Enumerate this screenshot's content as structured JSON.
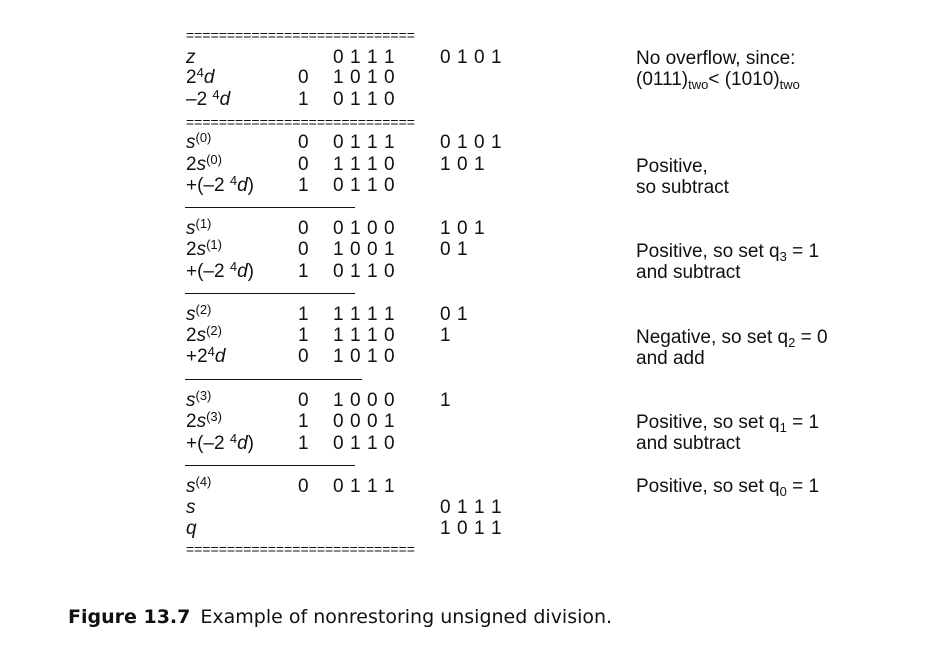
{
  "separator": "============================",
  "rows": [
    {
      "id": "z",
      "label": "z",
      "sign": "",
      "hi": "0 1 1 1",
      "lo": "0 1 0 1"
    },
    {
      "id": "24d",
      "label": "2⁴d",
      "sign": "0",
      "hi": "1 0 1 0",
      "lo": ""
    },
    {
      "id": "neg24d",
      "label": "–2 ⁴d",
      "sign": "1",
      "hi": "0 1 1 0",
      "lo": ""
    },
    {
      "id": "s0",
      "label": "s(0)",
      "sign": "0",
      "hi": "0 1 1 1",
      "lo": "0 1 0 1"
    },
    {
      "id": "2s0",
      "label": "2s(0)",
      "sign": "0",
      "hi": "1 1 1 0",
      "lo": "1 0 1"
    },
    {
      "id": "add0",
      "label": "+(–2 ⁴d)",
      "sign": "1",
      "hi": "0 1 1 0",
      "lo": ""
    },
    {
      "id": "s1",
      "label": "s(1)",
      "sign": "0",
      "hi": "0 1 0 0",
      "lo": "1 0 1"
    },
    {
      "id": "2s1",
      "label": "2s(1)",
      "sign": "0",
      "hi": "1 0 0 1",
      "lo": "0 1"
    },
    {
      "id": "add1",
      "label": "+(–2 ⁴d)",
      "sign": "1",
      "hi": "0 1 1 0",
      "lo": ""
    },
    {
      "id": "s2",
      "label": "s(2)",
      "sign": "1",
      "hi": "1 1 1 1",
      "lo": "0 1"
    },
    {
      "id": "2s2",
      "label": "2s(2)",
      "sign": "1",
      "hi": "1 1 1 0",
      "lo": "1"
    },
    {
      "id": "add2",
      "label": "+2⁴d",
      "sign": "0",
      "hi": "1 0 1 0",
      "lo": ""
    },
    {
      "id": "s3",
      "label": "s(3)",
      "sign": "0",
      "hi": "1 0 0 0",
      "lo": "1"
    },
    {
      "id": "2s3",
      "label": "2s(3)",
      "sign": "1",
      "hi": "0 0 0 1",
      "lo": ""
    },
    {
      "id": "add3",
      "label": "+(–2 ⁴d)",
      "sign": "1",
      "hi": "0 1 1 0",
      "lo": ""
    },
    {
      "id": "s4",
      "label": "s(4)",
      "sign": "0",
      "hi": "0 1 1 1",
      "lo": ""
    },
    {
      "id": "s",
      "label": "s",
      "sign": "",
      "hi": "",
      "lo": "0 1 1 1"
    },
    {
      "id": "q",
      "label": "q",
      "sign": "",
      "hi": "",
      "lo": "1 0 1 1"
    }
  ],
  "notes": {
    "overflow": {
      "line1": "No overflow, since:",
      "line2_a": "(0111)",
      "sub_a": "two",
      "line2_b": "< (1010)",
      "sub_b": "two"
    },
    "step0": {
      "line1": "Positive,",
      "line2": "so subtract"
    },
    "step1": {
      "line1_a": "Positive, so set q",
      "sub": "3",
      "line1_b": " = 1",
      "line2": "and subtract"
    },
    "step2": {
      "line1_a": "Negative, so set q",
      "sub": "2",
      "line1_b": " = 0",
      "line2": "and add"
    },
    "step3": {
      "line1_a": "Positive, so set q",
      "sub": "1",
      "line1_b": " = 1",
      "line2": "and subtract"
    },
    "step4": {
      "line1_a": "Positive, so set q",
      "sub": "0",
      "line1_b": " = 1"
    }
  },
  "caption": {
    "number": "Figure 13.7",
    "text": "Example of nonrestoring unsigned division."
  }
}
